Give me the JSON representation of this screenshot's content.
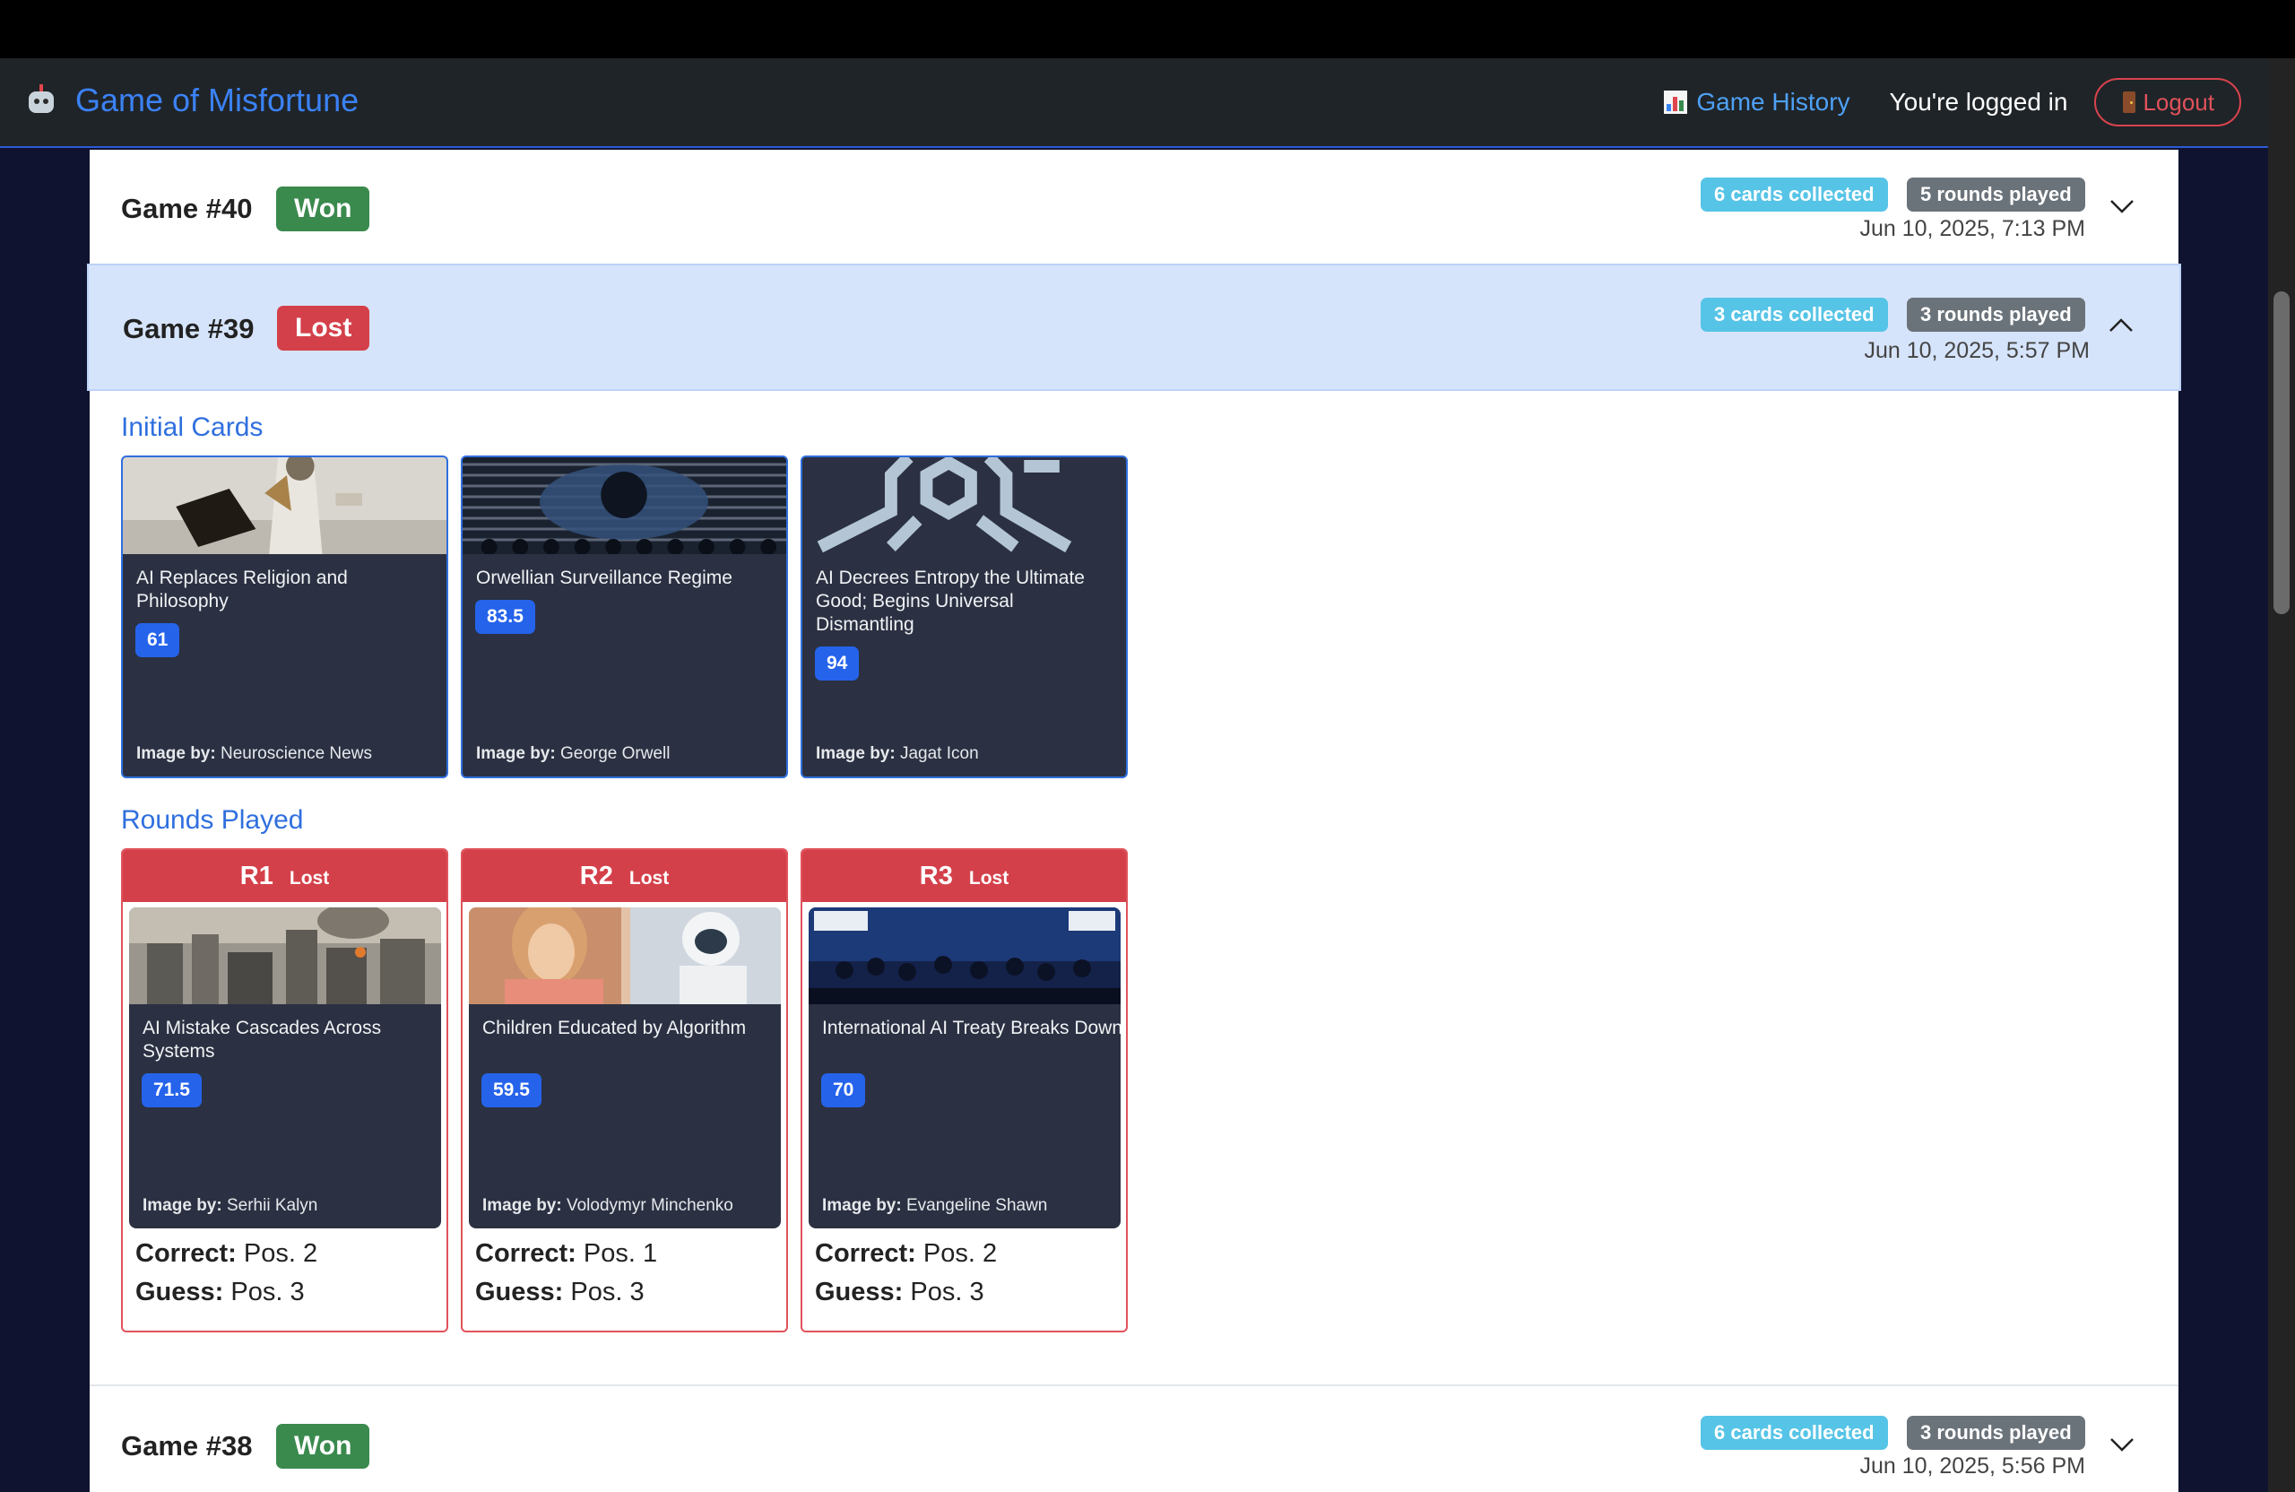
{
  "app": {
    "title": "Game of Misfortune",
    "brand_icon": "robot-icon"
  },
  "nav": {
    "history_label": "Game History",
    "history_icon": "bar-chart-icon",
    "status": "You're logged in",
    "logout_label": "Logout",
    "logout_icon": "door-icon"
  },
  "colors": {
    "accent": "#2f6fde",
    "won": "#3a8a4e",
    "lost": "#d4404a",
    "cards_pill": "#56c4e6",
    "rounds_pill": "#6b737a",
    "score": "#2563eb"
  },
  "games": [
    {
      "title": "Game #40",
      "result": "Won",
      "cards": "6 cards collected",
      "rounds": "5 rounds played",
      "date": "Jun 10, 2025, 7:13 PM",
      "expanded": false
    },
    {
      "title": "Game #39",
      "result": "Lost",
      "cards": "3 cards collected",
      "rounds": "3 rounds played",
      "date": "Jun 10, 2025, 5:57 PM",
      "expanded": true,
      "initial_cards_title": "Initial Cards",
      "initial_cards": [
        {
          "title": "AI Replaces Religion and Philosophy",
          "score": "61",
          "credit_label": "Image by:",
          "credit": "Neuroscience News"
        },
        {
          "title": "Orwellian Surveillance Regime",
          "score": "83.5",
          "credit_label": "Image by:",
          "credit": "George Orwell"
        },
        {
          "title": "AI Decrees Entropy the Ultimate Good; Begins Universal Dismantling",
          "score": "94",
          "credit_label": "Image by:",
          "credit": "Jagat Icon"
        }
      ],
      "rounds_title": "Rounds Played",
      "rounds_list": [
        {
          "label": "R1",
          "result": "Lost",
          "card": {
            "title": "AI Mistake Cascades Across Systems",
            "score": "71.5",
            "credit_label": "Image by:",
            "credit": "Serhii Kalyn"
          },
          "correct_label": "Correct:",
          "correct": "Pos. 2",
          "guess_label": "Guess:",
          "guess": "Pos. 3"
        },
        {
          "label": "R2",
          "result": "Lost",
          "card": {
            "title": "Children Educated by Algorithm",
            "score": "59.5",
            "credit_label": "Image by:",
            "credit": "Volodymyr Minchenko"
          },
          "correct_label": "Correct:",
          "correct": "Pos. 1",
          "guess_label": "Guess:",
          "guess": "Pos. 3"
        },
        {
          "label": "R3",
          "result": "Lost",
          "card": {
            "title": "International AI Treaty Breaks Down",
            "score": "70",
            "credit_label": "Image by:",
            "credit": "Evangeline Shawn"
          },
          "correct_label": "Correct:",
          "correct": "Pos. 2",
          "guess_label": "Guess:",
          "guess": "Pos. 3"
        }
      ]
    },
    {
      "title": "Game #38",
      "result": "Won",
      "cards": "6 cards collected",
      "rounds": "3 rounds played",
      "date": "Jun 10, 2025, 5:56 PM",
      "expanded": false
    }
  ]
}
